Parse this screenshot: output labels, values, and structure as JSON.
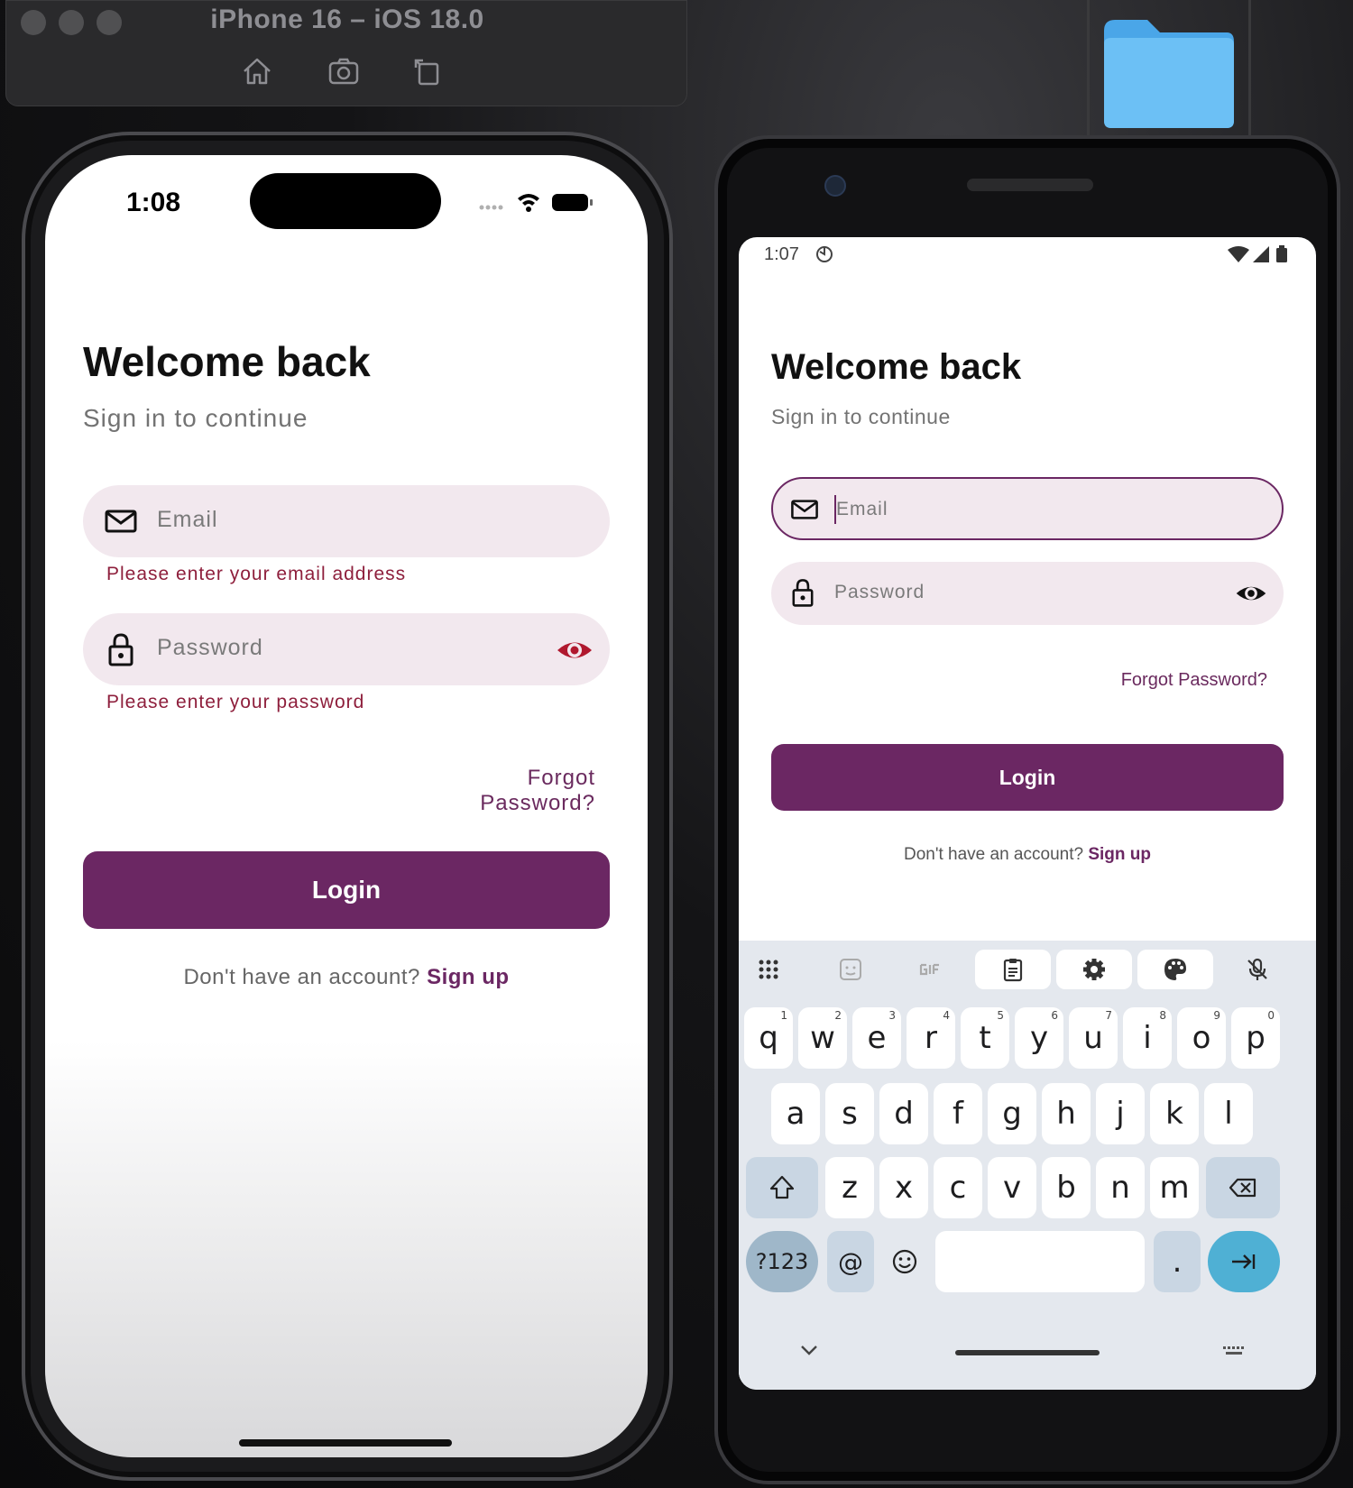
{
  "simulator": {
    "title": "iPhone 16 – iOS 18.0",
    "tools": [
      "home-icon",
      "screenshot-icon",
      "rotate-icon"
    ]
  },
  "ios": {
    "time": "1:08",
    "title": "Welcome back",
    "subtitle": "Sign in to continue",
    "email_placeholder": "Email",
    "email_error": "Please enter your email address",
    "password_placeholder": "Password",
    "password_error": "Please enter your password",
    "forgot": "Forgot Password?",
    "login": "Login",
    "signup_prompt": "Don't have an account?",
    "signup_link": "Sign up"
  },
  "android": {
    "time": "1:07",
    "title": "Welcome back",
    "subtitle": "Sign in to continue",
    "email_placeholder": "Email",
    "password_placeholder": "Password",
    "forgot": "Forgot Password?",
    "login": "Login",
    "signup_prompt": "Don't have an account?",
    "signup_link": "Sign up",
    "keyboard": {
      "row1": [
        {
          "k": "q",
          "h": "1"
        },
        {
          "k": "w",
          "h": "2"
        },
        {
          "k": "e",
          "h": "3"
        },
        {
          "k": "r",
          "h": "4"
        },
        {
          "k": "t",
          "h": "5"
        },
        {
          "k": "y",
          "h": "6"
        },
        {
          "k": "u",
          "h": "7"
        },
        {
          "k": "i",
          "h": "8"
        },
        {
          "k": "o",
          "h": "9"
        },
        {
          "k": "p",
          "h": "0"
        }
      ],
      "row2": [
        "a",
        "s",
        "d",
        "f",
        "g",
        "h",
        "j",
        "k",
        "l"
      ],
      "row3": [
        "z",
        "x",
        "c",
        "v",
        "b",
        "n",
        "m"
      ],
      "symbols": "?123",
      "at": "@",
      "period": "."
    }
  },
  "colors": {
    "primary": "#6b2763",
    "error": "#8e1f3c",
    "field_bg": "#f2e8ee",
    "eye_ios": "#b0182e"
  }
}
